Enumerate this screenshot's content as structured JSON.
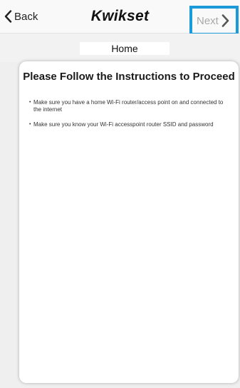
{
  "navbar": {
    "back_label": "Back",
    "logo_text": "Kwikset",
    "next_label": "Next"
  },
  "subheader": {
    "title": "Home"
  },
  "card": {
    "title": "Please Follow the Instructions to Proceed",
    "instructions": [
      "Make sure you have a home Wi-Fi router/access point on and connected to the internet",
      "Make sure you know your Wi-Fi accesspoint router SSID and password"
    ]
  },
  "colors": {
    "highlight_border": "#1a9ad9",
    "disabled_text": "#a9a9a9"
  },
  "icons": {
    "back": "chevron-left-icon",
    "next": "chevron-right-icon"
  }
}
